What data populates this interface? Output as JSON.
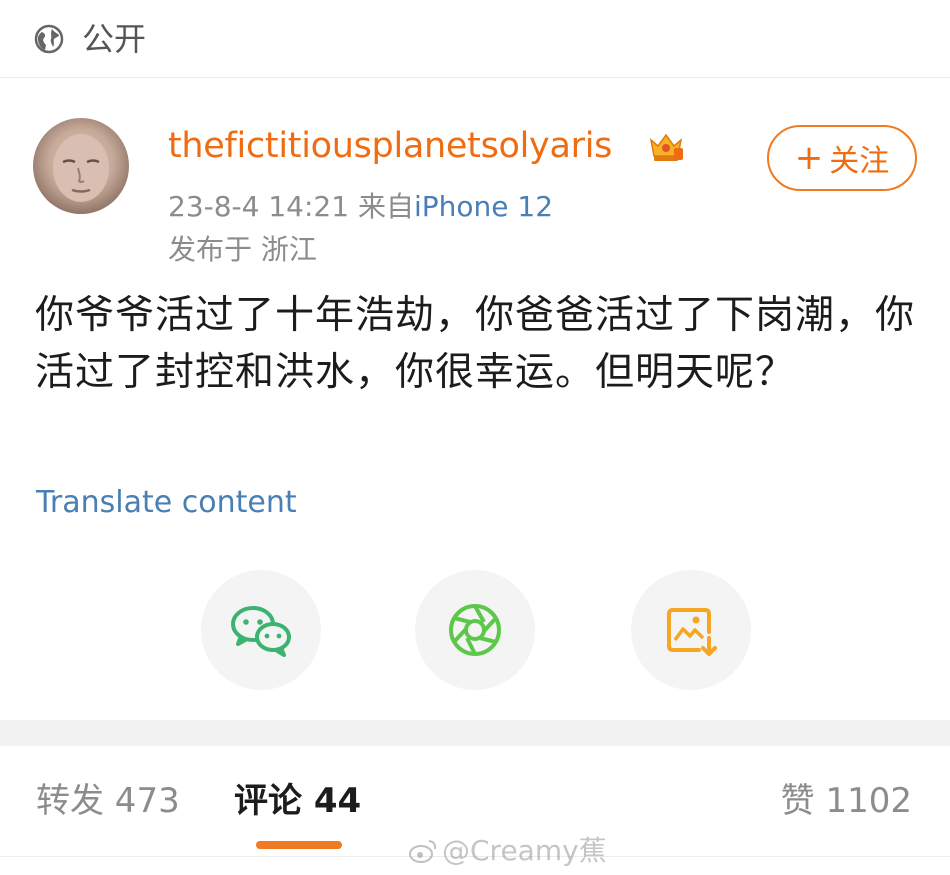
{
  "header": {
    "visibility_icon": "globe-icon",
    "visibility_label": "公开"
  },
  "author": {
    "username": "thefictitiousplanetsolyaris",
    "badge_icon": "vip-crown-icon",
    "follow_label": "关注",
    "follow_icon": "plus-icon",
    "timestamp": "23-8-4 14:21",
    "source_prefix": "来自",
    "device": "iPhone 12",
    "location": "发布于 浙江"
  },
  "post": {
    "text": "你爷爷活过了十年浩劫，你爸爸活过了下岗潮，你活过了封控和洪水，你很幸运。但明天呢？",
    "translate_label": "Translate content"
  },
  "share": {
    "wechat_icon": "wechat-icon",
    "moments_icon": "moments-icon",
    "save_image_icon": "save-image-icon"
  },
  "tabs": {
    "repost_label": "转发 473",
    "comment_label": "评论 44",
    "like_label": "赞 1102"
  },
  "watermark": {
    "text": "@Creamy蕉"
  },
  "colors": {
    "accent": "#f06c12",
    "link": "#4a7fb5",
    "wechat": "#3cb371",
    "moments": "#5cc84a",
    "save": "#f5a623"
  }
}
